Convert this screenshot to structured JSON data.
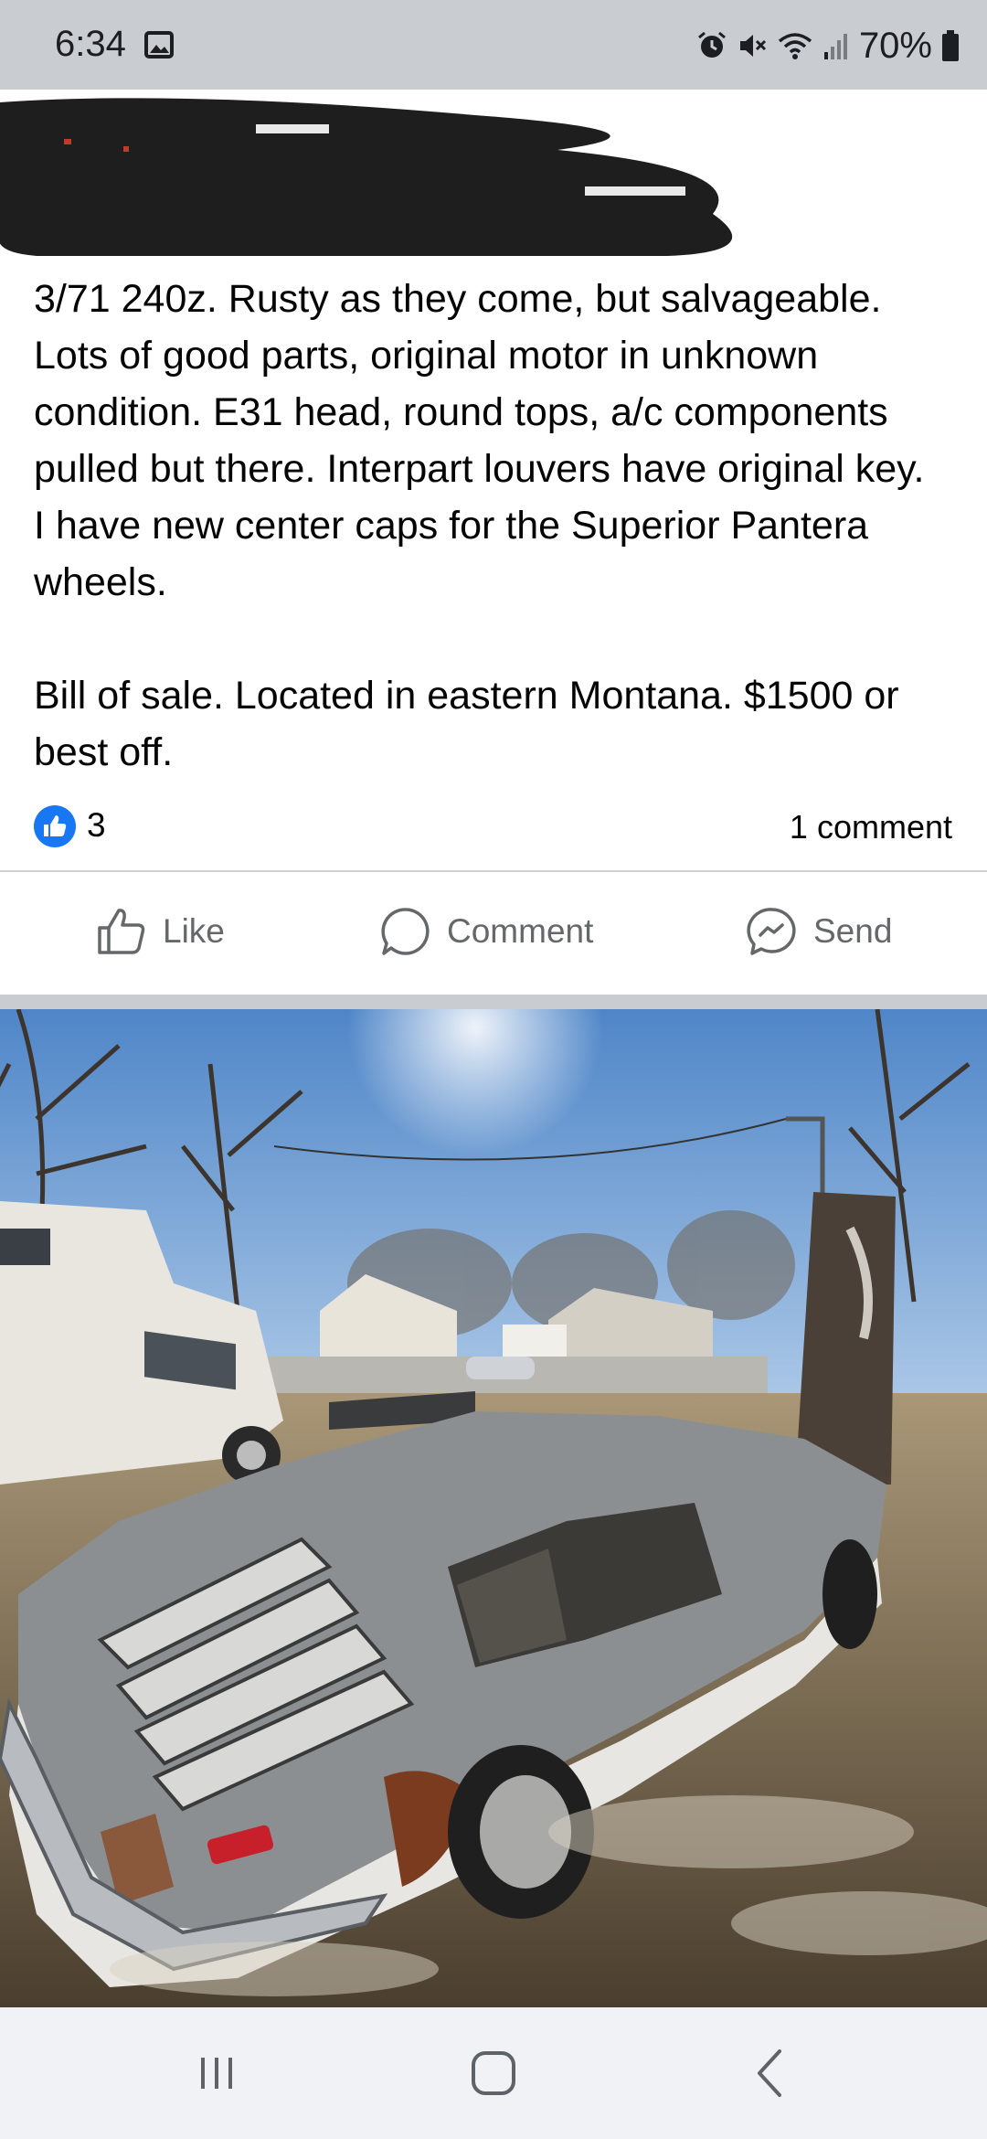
{
  "status_bar": {
    "time": "6:34",
    "battery": "70%",
    "icons": [
      "image-icon",
      "alarm-icon",
      "mute-icon",
      "wifi-icon",
      "signal-icon",
      "battery-icon"
    ]
  },
  "post": {
    "body": "3/71 240z. Rusty as they come, but salvageable. Lots of good parts, original motor in unknown condition. E31 head, round tops, a/c components pulled but there. Interpart louvers have original key.  I have new center caps for the Superior Pantera wheels.\n\nBill of sale. Located in eastern Montana. $1500 or best off.",
    "like_count": "3",
    "comment_count": "1 comment"
  },
  "actions": {
    "like": "Like",
    "comment": "Comment",
    "send": "Send"
  },
  "colors": {
    "facebook_blue": "#1877f2",
    "secondary_text": "#65676b",
    "status_bar_bg": "#c9ccd1"
  }
}
